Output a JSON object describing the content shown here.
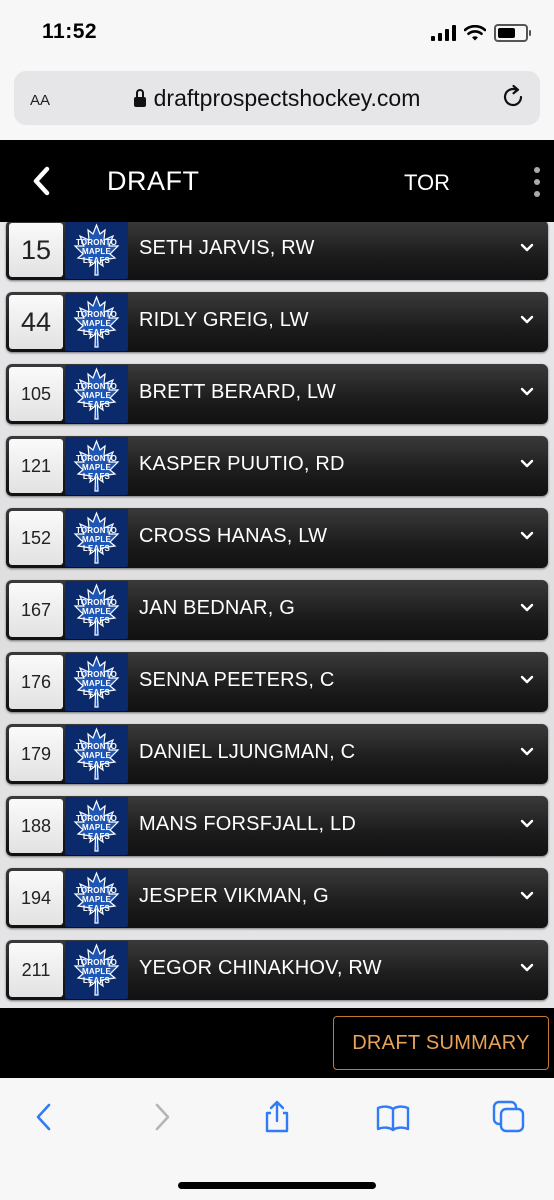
{
  "status_bar": {
    "time": "11:52"
  },
  "browser": {
    "text_size_label": "AA",
    "url": "draftprospectshockey.com"
  },
  "header": {
    "title": "DRAFT",
    "team_code": "TOR"
  },
  "team_logo": {
    "line1": "TORONTO",
    "line2": "MAPLE",
    "line3": "LEAFS"
  },
  "picks": [
    {
      "number": "15",
      "player": "SETH JARVIS, RW"
    },
    {
      "number": "44",
      "player": "RIDLY GREIG, LW"
    },
    {
      "number": "105",
      "player": "BRETT BERARD, LW"
    },
    {
      "number": "121",
      "player": "KASPER PUUTIO, RD"
    },
    {
      "number": "152",
      "player": "CROSS HANAS, LW"
    },
    {
      "number": "167",
      "player": "JAN BEDNAR, G"
    },
    {
      "number": "176",
      "player": "SENNA PEETERS, C"
    },
    {
      "number": "179",
      "player": "DANIEL LJUNGMAN, C"
    },
    {
      "number": "188",
      "player": "MANS FORSFJALL, LD"
    },
    {
      "number": "194",
      "player": "JESPER VIKMAN, G"
    },
    {
      "number": "211",
      "player": "YEGOR CHINAKHOV, RW"
    }
  ],
  "footer": {
    "summary_label": "DRAFT SUMMARY"
  },
  "colors": {
    "accent": "#e8a35a",
    "header_bg": "#000000",
    "logo_bg": "#0b2a6b",
    "safari_tint": "#2f7cf6"
  }
}
